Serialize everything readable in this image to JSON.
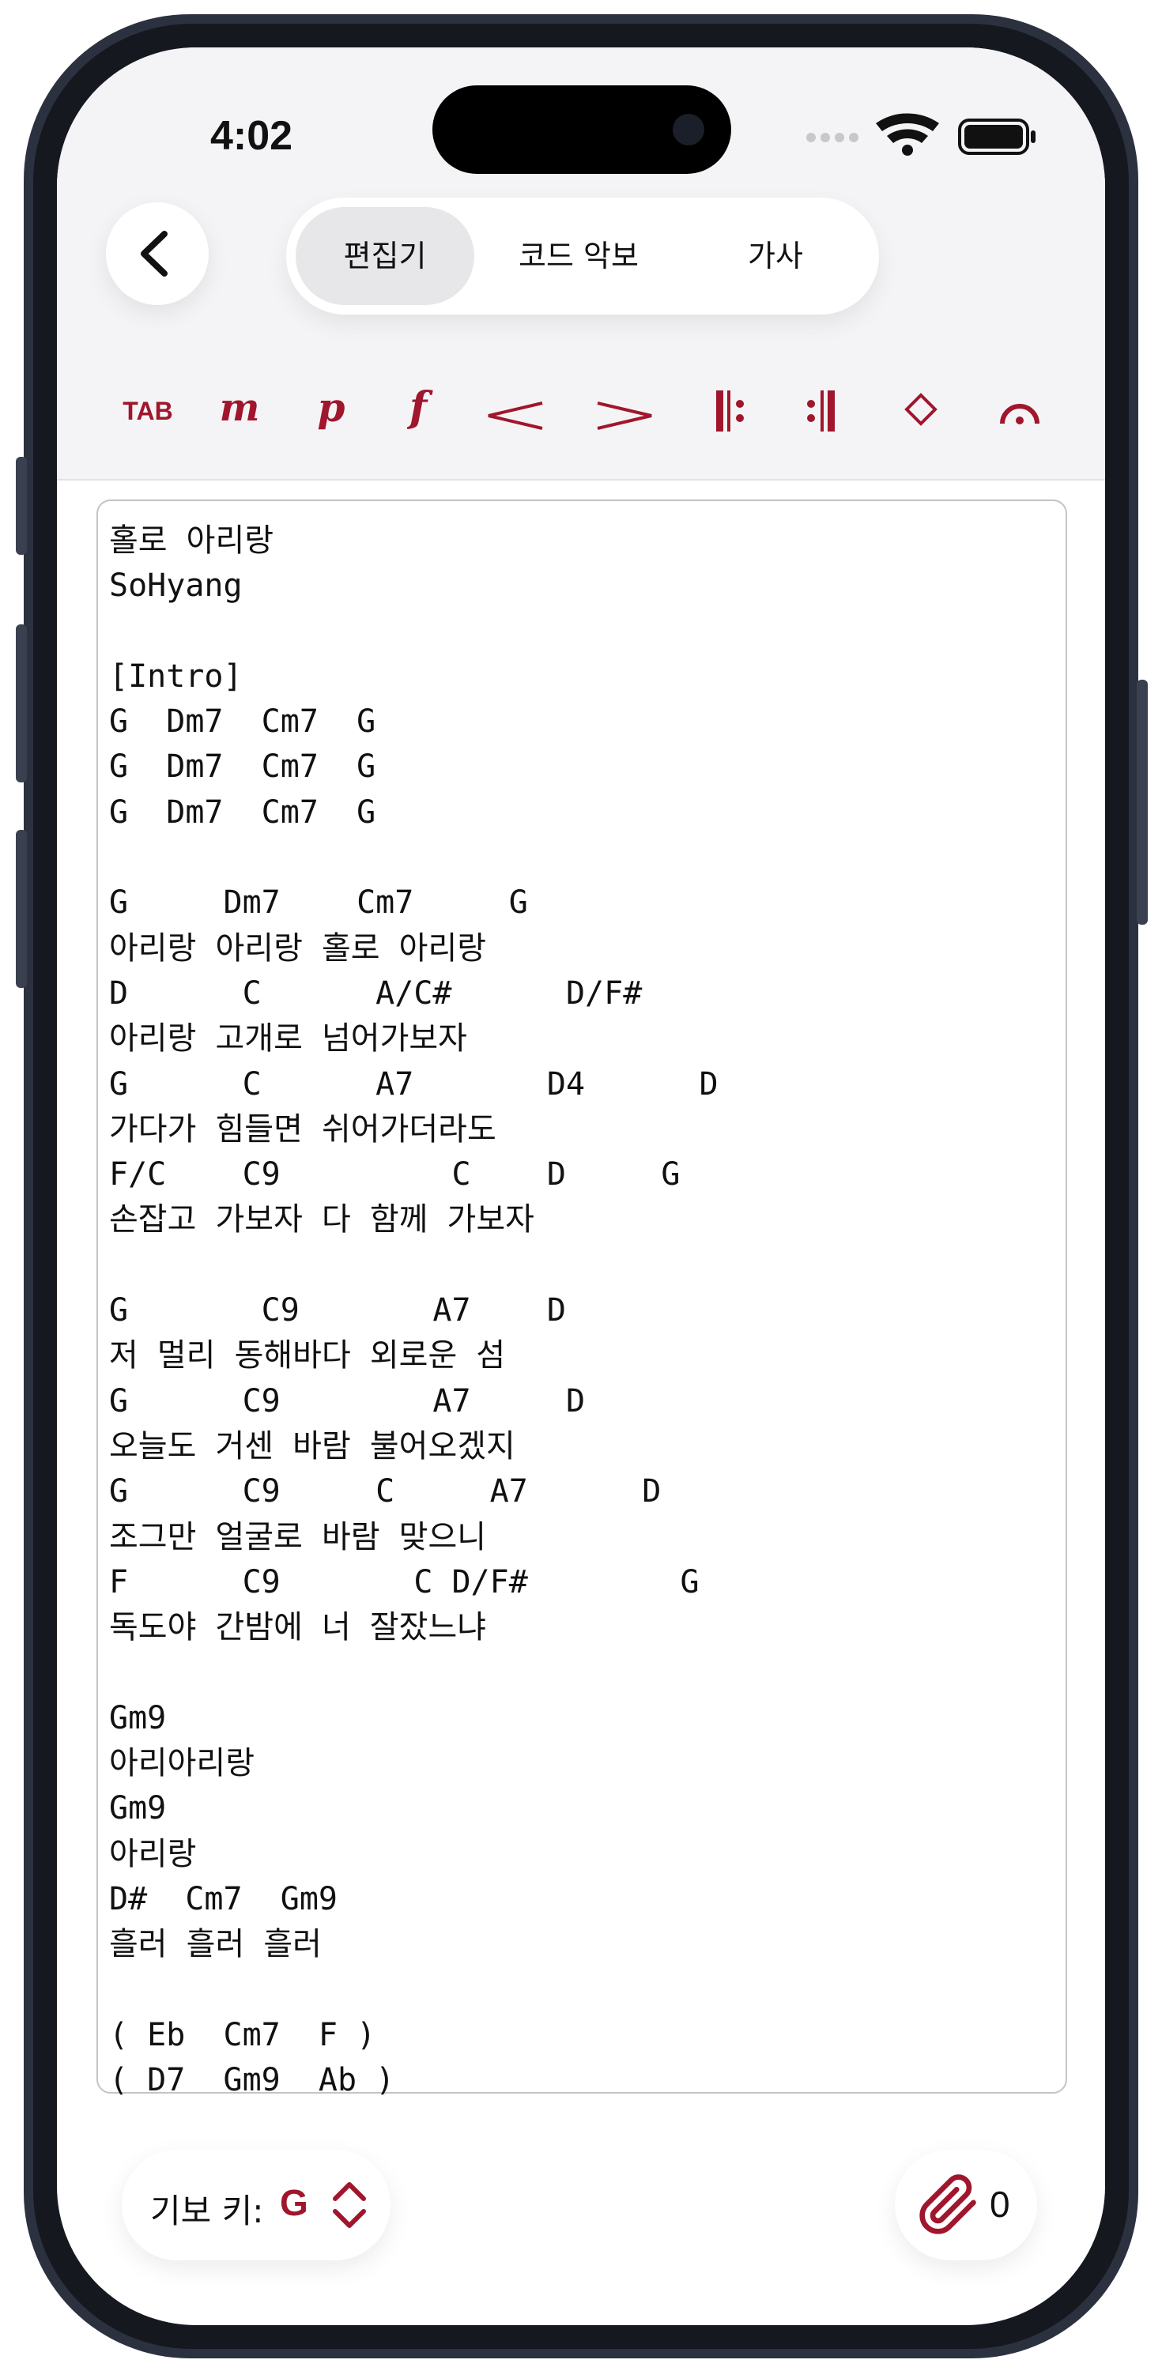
{
  "status_bar": {
    "time": "4:02"
  },
  "segments": [
    {
      "label": "편집기"
    },
    {
      "label": "코드 악보"
    },
    {
      "label": "가사"
    }
  ],
  "toolbar": {
    "items": [
      "TAB",
      "m",
      "p",
      "f",
      "<",
      ">",
      "𝄆",
      "𝄇",
      "◇",
      "fermata"
    ]
  },
  "editor": {
    "text": "홀로 아리랑\nSoHyang\n\n[Intro]\nG  Dm7  Cm7  G\nG  Dm7  Cm7  G\nG  Dm7  Cm7  G\n\nG     Dm7    Cm7     G\n아리랑 아리랑 홀로 아리랑\nD      C      A/C#      D/F#\n아리랑 고개로 넘어가보자\nG      C      A7       D4      D\n가다가 힘들면 쉬어가더라도\nF/C    C9         C    D     G\n손잡고 가보자 다 함께 가보자\n\nG       C9       A7    D\n저 멀리 동해바다 외로운 섬\nG      C9        A7     D\n오늘도 거센 바람 불어오겠지\nG      C9     C     A7      D\n조그만 얼굴로 바람 맞으니\nF      C9       C D/F#        G\n독도야 간밤에 너 잘잤느냐\n\nGm9\n아리아리랑\nGm9\n아리랑\nD#  Cm7  Gm9\n흘러 흘러 흘러\n\n( Eb  Cm7  F )\n( D7  Gm9  Ab )"
  },
  "footer": {
    "key_label": "기보 키:",
    "key_value": "G",
    "attachment_count": "0"
  },
  "colors": {
    "accent": "#a0162c"
  }
}
